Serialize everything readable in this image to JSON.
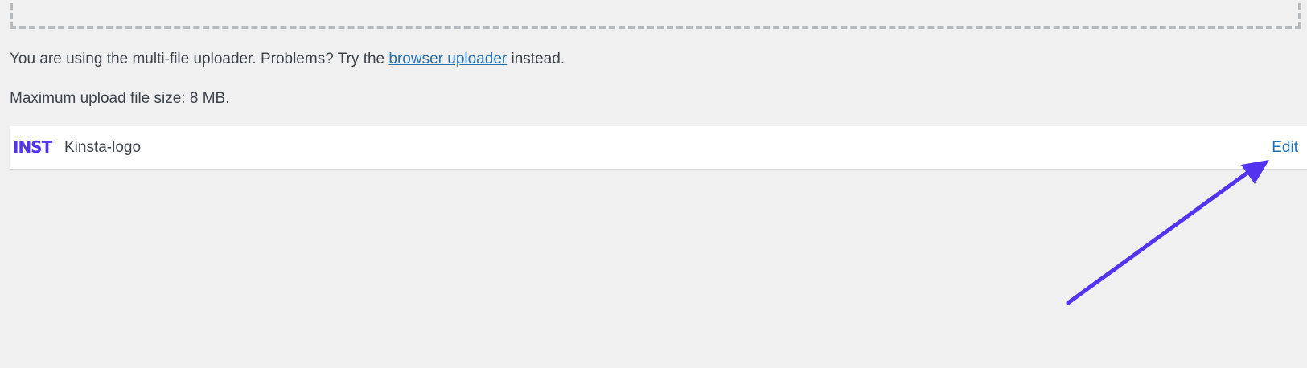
{
  "upload": {
    "message_before": "You are using the multi-file uploader. Problems? Try the ",
    "browser_uploader_link": "browser uploader",
    "message_after": " instead.",
    "max_size": "Maximum upload file size: 8 MB."
  },
  "media_item": {
    "thumbnail_icon": "kinsta-logo-thumbnail",
    "thumbnail_text": "INST",
    "filename": "Kinsta-logo",
    "edit_label": "Edit"
  },
  "colors": {
    "background": "#f0f0f1",
    "link": "#2271b1",
    "brand_purple": "#5333ed",
    "arrow": "#5333ed"
  }
}
